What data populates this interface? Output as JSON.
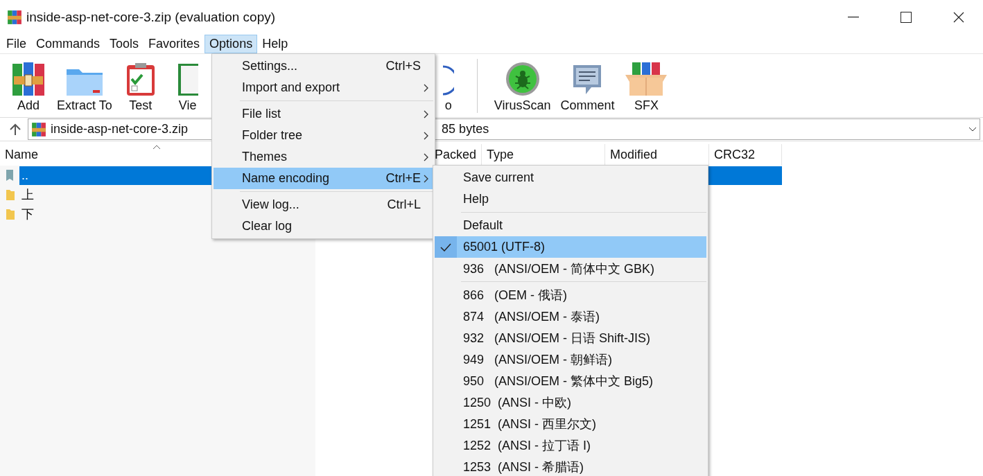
{
  "window": {
    "title": "inside-asp-net-core-3.zip (evaluation copy)"
  },
  "menubar": [
    {
      "label": "File",
      "selected": false
    },
    {
      "label": "Commands",
      "selected": false
    },
    {
      "label": "Tools",
      "selected": false
    },
    {
      "label": "Favorites",
      "selected": false
    },
    {
      "label": "Options",
      "selected": true
    },
    {
      "label": "Help",
      "selected": false
    }
  ],
  "toolbar": {
    "left": [
      {
        "kind": "books",
        "label": "Add"
      },
      {
        "kind": "folder",
        "label": "Extract To"
      },
      {
        "kind": "clipboard",
        "label": "Test"
      },
      {
        "kind": "book",
        "label": "Vie"
      }
    ],
    "right": [
      {
        "kind": "info",
        "label": "o"
      },
      {
        "kind": "virus",
        "label": "VirusScan"
      },
      {
        "kind": "comment",
        "label": "Comment"
      },
      {
        "kind": "box",
        "label": "SFX"
      }
    ]
  },
  "address": {
    "path": "inside-asp-net-core-3.zip",
    "tail": "85 bytes"
  },
  "table": {
    "columns": [
      {
        "label": "Name",
        "sorted": true
      },
      {
        "label": "Packed",
        "sorted": false
      },
      {
        "label": "Type",
        "sorted": false
      },
      {
        "label": "Modified",
        "sorted": false
      },
      {
        "label": "CRC32",
        "sorted": false
      }
    ],
    "rows": [
      {
        "kind": "parent",
        "name": "..",
        "selected": true
      },
      {
        "kind": "folder",
        "name": "上",
        "selected": false
      },
      {
        "kind": "folder",
        "name": "下",
        "selected": false
      }
    ]
  },
  "options_menu": [
    {
      "kind": "item",
      "label": "Settings...",
      "shortcut": "Ctrl+S",
      "submenu": false,
      "selected": false
    },
    {
      "kind": "item",
      "label": "Import and export",
      "submenu": true,
      "selected": false
    },
    {
      "kind": "separator"
    },
    {
      "kind": "item",
      "label": "File list",
      "submenu": true,
      "selected": false
    },
    {
      "kind": "item",
      "label": "Folder tree",
      "submenu": true,
      "selected": false
    },
    {
      "kind": "item",
      "label": "Themes",
      "submenu": true,
      "selected": false
    },
    {
      "kind": "item",
      "label": "Name encoding",
      "shortcut": "Ctrl+E",
      "submenu": true,
      "selected": true
    },
    {
      "kind": "separator"
    },
    {
      "kind": "item",
      "label": "View log...",
      "shortcut": "Ctrl+L",
      "submenu": false,
      "selected": false
    },
    {
      "kind": "item",
      "label": "Clear log",
      "submenu": false,
      "selected": false
    }
  ],
  "encoding_menu": [
    {
      "kind": "item",
      "label": "Save current",
      "checked": false,
      "selected": false
    },
    {
      "kind": "item",
      "label": "Help",
      "checked": false,
      "selected": false
    },
    {
      "kind": "separator"
    },
    {
      "kind": "item",
      "label": "Default",
      "checked": false,
      "selected": false
    },
    {
      "kind": "item",
      "label": "65001 (UTF-8)",
      "checked": true,
      "selected": true
    },
    {
      "kind": "item",
      "label": "936   (ANSI/OEM - 简体中文 GBK)",
      "checked": false,
      "selected": false
    },
    {
      "kind": "separator"
    },
    {
      "kind": "item",
      "label": "866   (OEM - 俄语)",
      "checked": false,
      "selected": false
    },
    {
      "kind": "item",
      "label": "874   (ANSI/OEM - 泰语)",
      "checked": false,
      "selected": false
    },
    {
      "kind": "item",
      "label": "932   (ANSI/OEM - 日语 Shift-JIS)",
      "checked": false,
      "selected": false
    },
    {
      "kind": "item",
      "label": "949   (ANSI/OEM - 朝鲜语)",
      "checked": false,
      "selected": false
    },
    {
      "kind": "item",
      "label": "950   (ANSI/OEM - 繁体中文 Big5)",
      "checked": false,
      "selected": false
    },
    {
      "kind": "item",
      "label": "1250  (ANSI - 中欧)",
      "checked": false,
      "selected": false
    },
    {
      "kind": "item",
      "label": "1251  (ANSI - 西里尔文)",
      "checked": false,
      "selected": false
    },
    {
      "kind": "item",
      "label": "1252  (ANSI - 拉丁语 I)",
      "checked": false,
      "selected": false
    },
    {
      "kind": "item",
      "label": "1253  (ANSI - 希腊语)",
      "checked": false,
      "selected": false
    }
  ]
}
